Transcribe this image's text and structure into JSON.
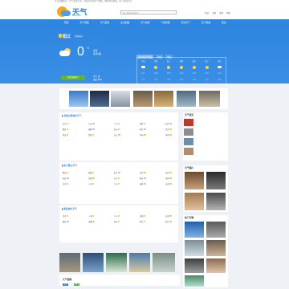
{
  "top_notice": "今日温馨提示：天气变化无常，请及时关注天气预报，做好防范措施，出门注意安全",
  "header": {
    "logo_text": "天气",
    "logo_sub": "tianqi.com",
    "search_placeholder": "输入城市名查天气",
    "links": [
      "登录",
      "注册",
      "设置",
      "帮助"
    ]
  },
  "nav": {
    "items": [
      "首页",
      "天气预报",
      "空气质量",
      "生活指数",
      "天气新闻",
      "气象预警",
      "历史天气",
      "天气视频",
      "更多"
    ]
  },
  "hero": {
    "city": "阳江",
    "city_sub": "切换城市",
    "temperature": "0",
    "unit": "℃",
    "condition_line1": "多云",
    "condition_line2": "北风1级",
    "button": "查看详细天气",
    "aqi_line1": "空气 良",
    "aqi_line2": "湿度 65%"
  },
  "forecast": {
    "tabs": [
      "未来7天天气预报",
      "15天",
      "40天"
    ],
    "days": [
      "今天",
      "明天",
      "周三",
      "周四",
      "周五",
      "周六",
      "周日"
    ],
    "icons": [
      "cloudy",
      "sunny",
      "sunny",
      "sunny",
      "sunny",
      "sunny",
      "cloudy"
    ],
    "highs": [
      "8℃",
      "10℃",
      "11℃",
      "12℃",
      "12℃",
      "11℃",
      "9℃"
    ],
    "lows": [
      "2℃",
      "3℃",
      "4℃",
      "4℃",
      "5℃",
      "3℃",
      "2℃"
    ],
    "winds": [
      "北风",
      "北风",
      "东北风",
      "东风",
      "东风",
      "北风",
      "北风"
    ]
  },
  "panels": {
    "p1_title": "全国主要城市天气",
    "p2_title": "热门景点天气",
    "p3_title": "国际城市天气",
    "side1_title": "天气资讯",
    "side2_title": "天气图片",
    "side3_title": "热门专题"
  },
  "city_rows": [
    [
      "北京",
      "上海",
      "广州",
      "深圳",
      "天津"
    ],
    [
      "重庆",
      "成都",
      "杭州",
      "南京",
      "武汉"
    ],
    [
      "西安",
      "沈阳",
      "长沙",
      "郑州",
      "济南"
    ]
  ],
  "bottom": {
    "title": "天气视频",
    "chips": [
      "更多",
      "热门"
    ]
  },
  "colors": {
    "primary": "#2f86e0",
    "green": "#5fb336",
    "sun": "#f8c23e"
  }
}
